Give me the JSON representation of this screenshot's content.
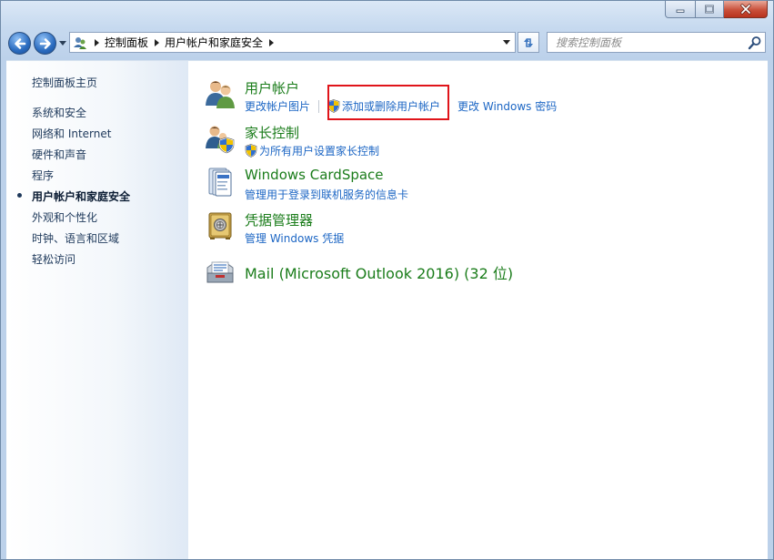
{
  "window": {
    "colors": {
      "title_bar": "#c6d9ef",
      "close_red": "#c9503a",
      "link_blue": "#1c66c4",
      "category_green": "#1a7c1a",
      "highlight_red": "#e0141a"
    }
  },
  "address_bar": {
    "breadcrumbs": [
      "控制面板",
      "用户帐户和家庭安全"
    ]
  },
  "search": {
    "placeholder": "搜索控制面板"
  },
  "sidebar": {
    "home": "控制面板主页",
    "items": [
      {
        "label": "系统和安全",
        "active": false
      },
      {
        "label": "网络和 Internet",
        "active": false
      },
      {
        "label": "硬件和声音",
        "active": false
      },
      {
        "label": "程序",
        "active": false
      },
      {
        "label": "用户帐户和家庭安全",
        "active": true
      },
      {
        "label": "外观和个性化",
        "active": false
      },
      {
        "label": "时钟、语言和区域",
        "active": false
      },
      {
        "label": "轻松访问",
        "active": false
      }
    ]
  },
  "categories": [
    {
      "title": "用户帐户",
      "icon": "user-accounts-icon",
      "links": [
        {
          "label": "更改帐户图片",
          "shield": false
        },
        {
          "label": "添加或删除用户帐户",
          "shield": true,
          "highlighted": true
        },
        {
          "label": "更改 Windows 密码",
          "shield": false
        }
      ]
    },
    {
      "title": "家长控制",
      "icon": "parental-controls-icon",
      "links": [
        {
          "label": "为所有用户设置家长控制",
          "shield": true
        }
      ]
    },
    {
      "title": "Windows CardSpace",
      "icon": "cardspace-icon",
      "links": [
        {
          "label": "管理用于登录到联机服务的信息卡",
          "shield": false
        }
      ]
    },
    {
      "title": "凭据管理器",
      "icon": "credential-manager-icon",
      "links": [
        {
          "label": "管理 Windows 凭据",
          "shield": false
        }
      ]
    },
    {
      "title": "Mail (Microsoft Outlook 2016) (32 位)",
      "icon": "mail-icon",
      "links": []
    }
  ]
}
